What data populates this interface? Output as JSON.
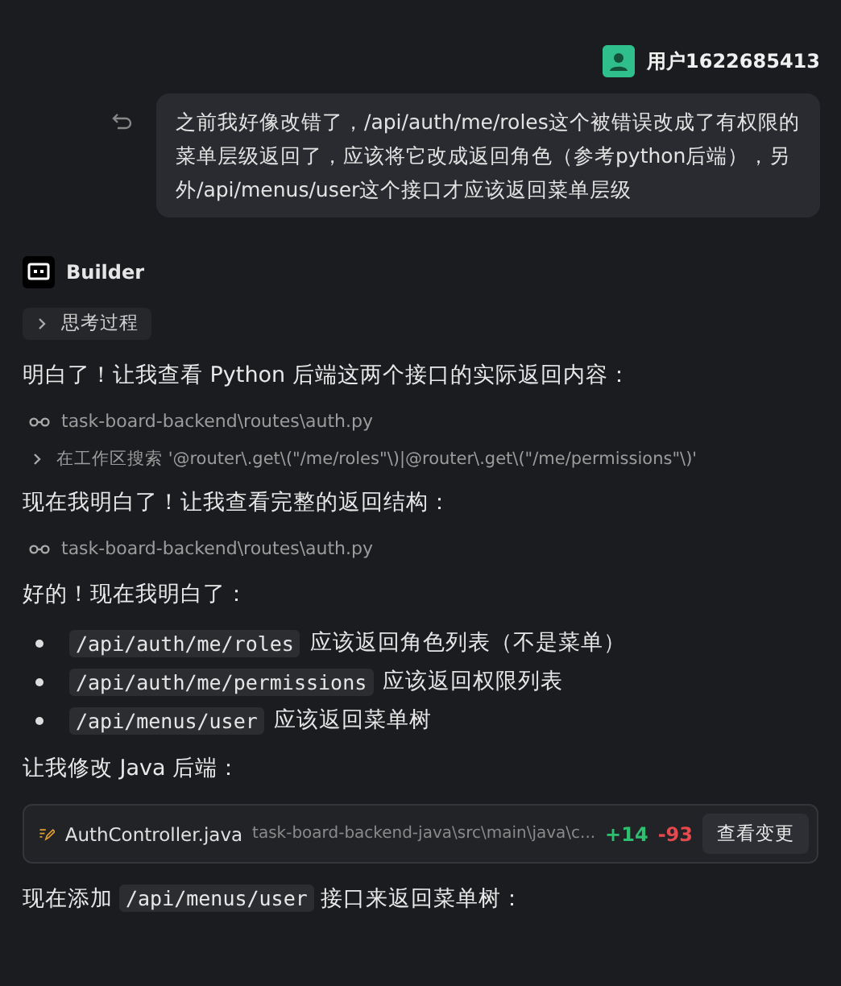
{
  "user_message": {
    "username": "用户1622685413",
    "text": "之前我好像改错了，/api/auth/me/roles这个被错误改成了有权限的菜单层级返回了，应该将它改成返回角色（参考python后端），另外/api/menus/user这个接口才应该返回菜单层级"
  },
  "assistant": {
    "name": "Builder",
    "thinking": {
      "label": "思考过程",
      "expanded": false
    },
    "blocks": [
      {
        "kind": "text",
        "parts": [
          {
            "kind": "plain",
            "text": "明白了！让我查看 Python 后端这两个接口的实际返回内容："
          }
        ]
      },
      {
        "kind": "file_read",
        "path": "task-board-backend\\routes\\auth.py"
      },
      {
        "kind": "search",
        "expanded": false,
        "text": "在工作区搜索 '@router\\.get\\(\"/me/roles\"\\)|@router\\.get\\(\"/me/permissions\"\\)'"
      },
      {
        "kind": "text",
        "parts": [
          {
            "kind": "plain",
            "text": "现在我明白了！让我查看完整的返回结构："
          }
        ]
      },
      {
        "kind": "file_read",
        "path": "task-board-backend\\routes\\auth.py"
      },
      {
        "kind": "text",
        "parts": [
          {
            "kind": "plain",
            "text": "好的！现在我明白了："
          }
        ]
      },
      {
        "kind": "bullets",
        "items": [
          [
            {
              "kind": "code",
              "text": "/api/auth/me/roles"
            },
            {
              "kind": "plain",
              "text": "应该返回角色列表（不是菜单）"
            }
          ],
          [
            {
              "kind": "code",
              "text": "/api/auth/me/permissions"
            },
            {
              "kind": "plain",
              "text": "应该返回权限列表"
            }
          ],
          [
            {
              "kind": "code",
              "text": "/api/menus/user"
            },
            {
              "kind": "plain",
              "text": "应该返回菜单树"
            }
          ]
        ]
      },
      {
        "kind": "text",
        "parts": [
          {
            "kind": "plain",
            "text": "让我修改 Java 后端："
          }
        ]
      },
      {
        "kind": "file_edit",
        "file": "AuthController.java",
        "path": "task-board-backend-java\\src\\main\\java\\c...",
        "added": "+14",
        "removed": "-93",
        "button": "查看变更"
      },
      {
        "kind": "text",
        "parts": [
          {
            "kind": "plain",
            "text": "现在添加"
          },
          {
            "kind": "code",
            "text": "/api/menus/user"
          },
          {
            "kind": "plain",
            "text": "接口来返回菜单树："
          }
        ]
      }
    ]
  }
}
